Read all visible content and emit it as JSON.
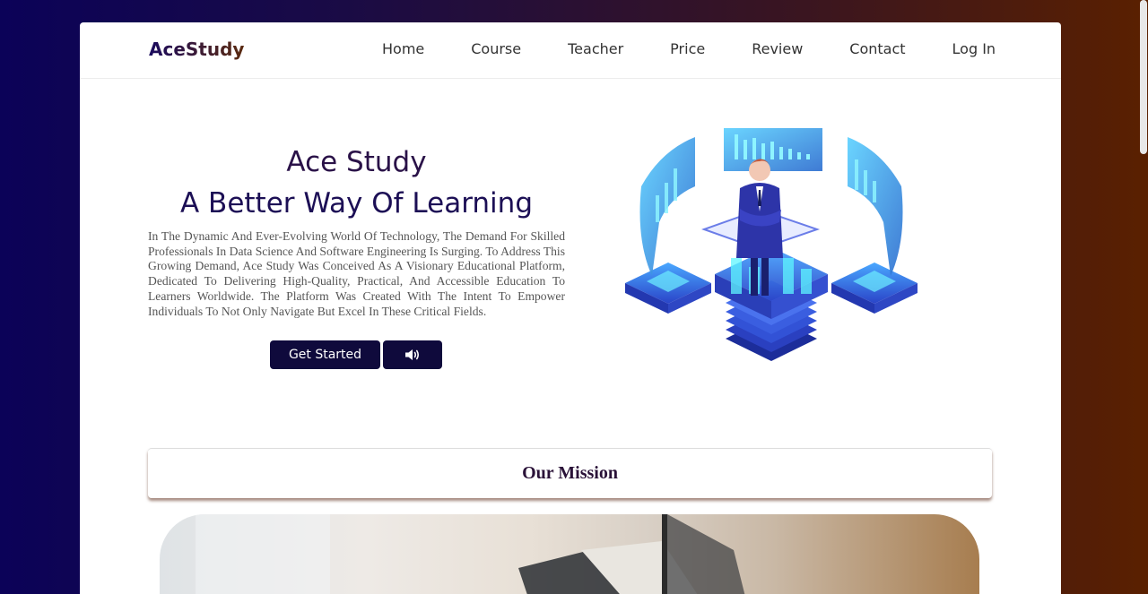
{
  "brand": {
    "logo": "AceStudy"
  },
  "nav": {
    "items": [
      "Home",
      "Course",
      "Teacher",
      "Price",
      "Review",
      "Contact",
      "Log In"
    ]
  },
  "hero": {
    "title": "Ace Study",
    "subtitle": "A Better Way Of Learning",
    "description": "In The Dynamic And Ever-Evolving World Of Technology, The Demand For Skilled Professionals In Data Science And Software Engineering Is Surging. To Address This Growing Demand, Ace Study Was Conceived As A Visionary Educational Platform, Dedicated To Delivering High-Quality, Practical, And Accessible Education To Learners Worldwide. The Platform Was Created With The Intent To Empower Individuals To Not Only Navigate But Excel In These Critical Fields.",
    "cta_label": "Get Started",
    "sound_icon": "speaker-icon"
  },
  "mission": {
    "title": "Our Mission"
  },
  "colors": {
    "button_bg": "#0f0a3c",
    "title": "#2a1248",
    "subtitle": "#1c0f55"
  }
}
